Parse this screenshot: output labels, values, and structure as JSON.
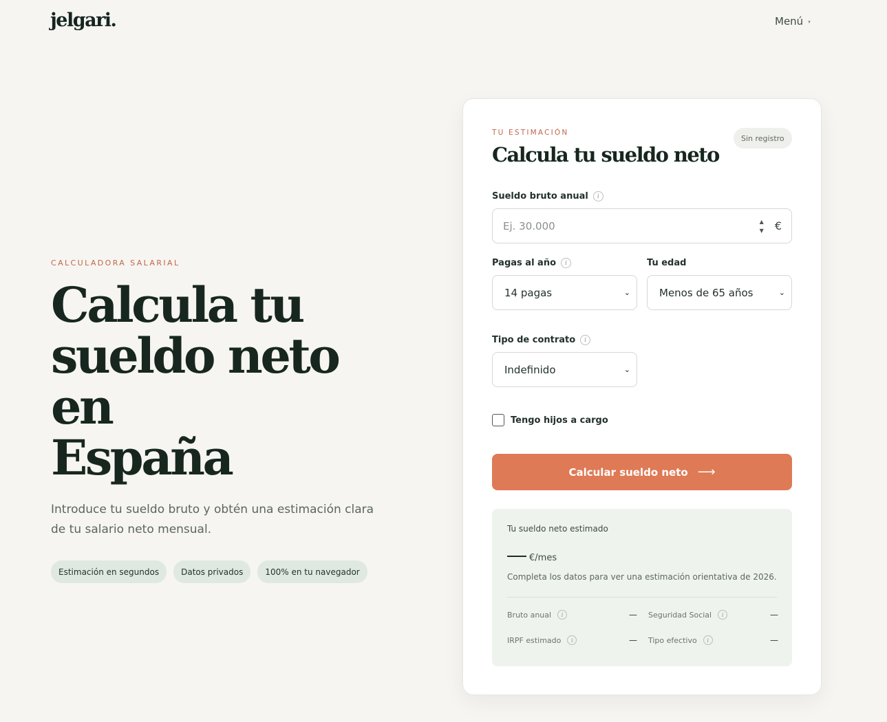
{
  "header": {
    "logo": "jelgari.",
    "menu_label": "Menú",
    "menu_caret": "▾"
  },
  "hero": {
    "eyebrow": "CALCULADORA SALARIAL",
    "title_line1": "Calcula tu",
    "title_line2": "sueldo neto en",
    "title_line3": "España",
    "lede": "Introduce tu sueldo bruto y obtén una estimación clara de tu salario neto mensual.",
    "chips": [
      "Estimación en segundos",
      "Datos privados",
      "100% en tu navegador"
    ]
  },
  "card": {
    "eyebrow": "TU ESTIMACIÓN",
    "title": "Calcula tu sueldo neto",
    "badge": "Sin registro",
    "gross": {
      "label": "Sueldo bruto anual",
      "placeholder": "Ej. 30.000",
      "value": "",
      "currency": "€"
    },
    "payments": {
      "label": "Pagas al año",
      "selected": "14 pagas"
    },
    "age": {
      "label": "Tu edad",
      "selected": "Menos de 65 años"
    },
    "contract": {
      "label": "Tipo de contrato",
      "selected": "Indefinido"
    },
    "children": {
      "label": "Tengo hijos a cargo",
      "checked": false
    },
    "cta_label": "Calcular sueldo neto",
    "cta_arrow": "⟶",
    "result": {
      "title": "Tu sueldo neto estimado",
      "unit": "€/mes",
      "note": "Completa los datos para ver una estimación orientativa de 2026.",
      "items": [
        {
          "label": "Bruto anual",
          "value": "—"
        },
        {
          "label": "Seguridad Social",
          "value": "—"
        },
        {
          "label": "IRPF estimado",
          "value": "—"
        },
        {
          "label": "Tipo efectivo",
          "value": "—"
        }
      ]
    }
  },
  "icons": {
    "info": "info-icon",
    "chevron": "chevron-down-icon",
    "arrow": "arrow-right-icon"
  }
}
